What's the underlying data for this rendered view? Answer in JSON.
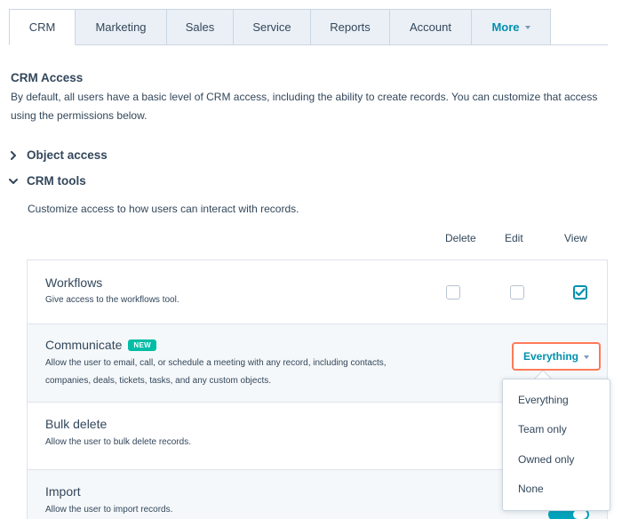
{
  "tabs": [
    {
      "label": "CRM",
      "active": true
    },
    {
      "label": "Marketing"
    },
    {
      "label": "Sales"
    },
    {
      "label": "Service"
    },
    {
      "label": "Reports"
    },
    {
      "label": "Account"
    },
    {
      "label": "More"
    }
  ],
  "crm_access": {
    "title": "CRM Access",
    "description": "By default, all users have a basic level of CRM access, including the ability to create records. You can customize that access using the permissions below."
  },
  "sections": {
    "object_access": {
      "label": "Object access",
      "expanded": false
    },
    "crm_tools": {
      "label": "CRM tools",
      "expanded": true,
      "description": "Customize access to how users can interact with records."
    }
  },
  "columns": {
    "delete": "Delete",
    "edit": "Edit",
    "view": "View"
  },
  "rows": [
    {
      "title": "Workflows",
      "description": "Give access to the workflows tool.",
      "delete": false,
      "edit": false,
      "view": true
    },
    {
      "title": "Communicate",
      "badge": "NEW",
      "description": "Allow the user to email, call, or schedule a meeting with any record, including contacts, companies, deals, tickets, tasks, and any custom objects.",
      "selected": "Everything"
    },
    {
      "title": "Bulk delete",
      "description": "Allow the user to bulk delete records."
    },
    {
      "title": "Import",
      "description": "Allow the user to import records."
    }
  ],
  "dropdown": {
    "options": [
      "Everything",
      "Team only",
      "Owned only",
      "None"
    ]
  },
  "colors": {
    "accent": "#0091ae",
    "highlight": "#ff7a59",
    "badge": "#00bda5",
    "text": "#33475b"
  }
}
